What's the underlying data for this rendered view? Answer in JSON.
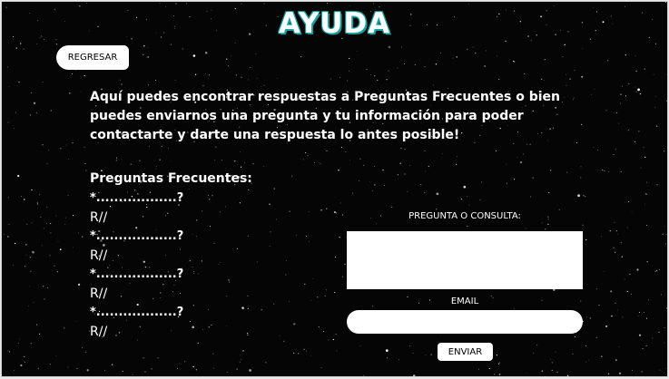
{
  "header": {
    "title": "AYUDA"
  },
  "nav": {
    "back_label": "REGRESAR"
  },
  "intro": {
    "text": "Aquí puedes encontrar respuestas a Preguntas Frecuentes o bien puedes enviarnos una pregunta y tu información para poder contactarte y darte una respuesta lo antes posible!"
  },
  "faq": {
    "title": "Preguntas Frecuentes:",
    "items": [
      {
        "question": "*..................?",
        "answer": "R//"
      },
      {
        "question": "*..................?",
        "answer": "R//"
      },
      {
        "question": "*..................?",
        "answer": "R//"
      },
      {
        "question": "*..................?",
        "answer": "R//"
      }
    ]
  },
  "form": {
    "question_label": "PREGUNTA O CONSULTA:",
    "question_value": "",
    "email_label": "EMAIL",
    "email_value": "",
    "submit_label": "ENVIAR"
  },
  "colors": {
    "background": "#050505",
    "title_glow": "#1a9a9a",
    "surface": "#ffffff"
  }
}
